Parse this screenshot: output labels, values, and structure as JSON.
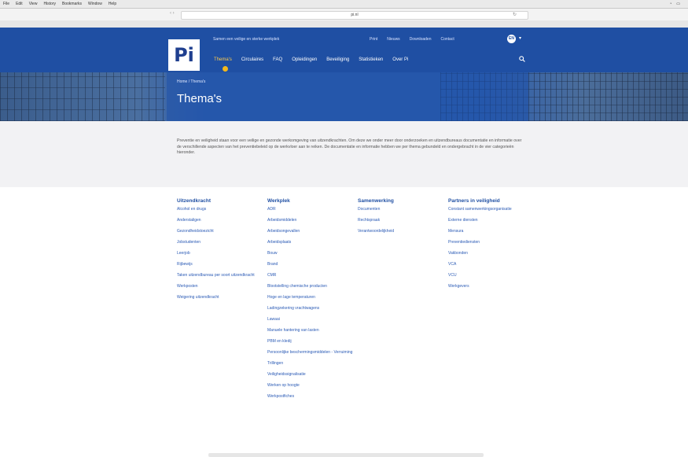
{
  "os": {
    "menu": [
      "File",
      "Edit",
      "View",
      "History",
      "Bookmarks",
      "Window",
      "Help"
    ]
  },
  "browser": {
    "address": "pi.nl"
  },
  "header": {
    "logo": "Pi",
    "tagline": "Samen een veilige en sterke werkplek",
    "top_links": [
      "Print",
      "Nieuws",
      "Downloaden",
      "Contact"
    ],
    "lang": "EN",
    "nav": [
      "Thema's",
      "Circulaires",
      "FAQ",
      "Opleidingen",
      "Beveiliging",
      "Statistieken",
      "Over Pi"
    ]
  },
  "hero": {
    "breadcrumb": "Home / Thema's",
    "title": "Thema's"
  },
  "intro": {
    "text": "Preventie en veiligheid staan voor een veilige en gezonde werkomgeving van uitzendkrachten. Om deze we onder meer door onderzoeken en uitzendbureaus documentatie en informatie over de verschillende aspecten van het preventiebeleid op de werkvloer aan te reiken. De documentatie en informatie hebben we per thema gebundeld en ondergebracht in de vier categorieën hieronder."
  },
  "columns": [
    {
      "title": "Uitzendkracht",
      "items": [
        "Alcohol en drugs",
        "Anderstaligen",
        "Gezondheidstoezicht",
        "Jobstudenten",
        "Leerjob",
        "Rijbewijs",
        "Taken uitzendbureau per soort uitzendkracht",
        "Werkposten",
        "Weigering uitzendkracht"
      ]
    },
    {
      "title": "Werkplek",
      "items": [
        "ADR",
        "Arbeidsmiddelen",
        "Arbeidsongevallen",
        "Arbeidsplaats",
        "Bouw",
        "Brand",
        "CMR",
        "Blootstelling chemische producten",
        "Hoge en lage temperaturen",
        "Ladingzekering vrachtwagens",
        "Lawaai",
        "Manuele hantering van lasten",
        "PBM en kledij",
        "Persoonlijke beschermingsmiddelen - Verruiming",
        "Trillingen",
        "Veiligheidssignalisatie",
        "Werken op hoogte",
        "Werkpostfiches"
      ]
    },
    {
      "title": "Samenwerking",
      "items": [
        "Documenten",
        "Rechtspraak",
        "Verantwoordelijkheid"
      ]
    },
    {
      "title": "Partners in veiligheid",
      "items": [
        "Constant samenwerkingsorganisatie",
        "Externe diensten",
        "Mensura",
        "Preventiediensten",
        "Vakbonden",
        "VCA",
        "VCU",
        "Werkgevers"
      ]
    }
  ]
}
